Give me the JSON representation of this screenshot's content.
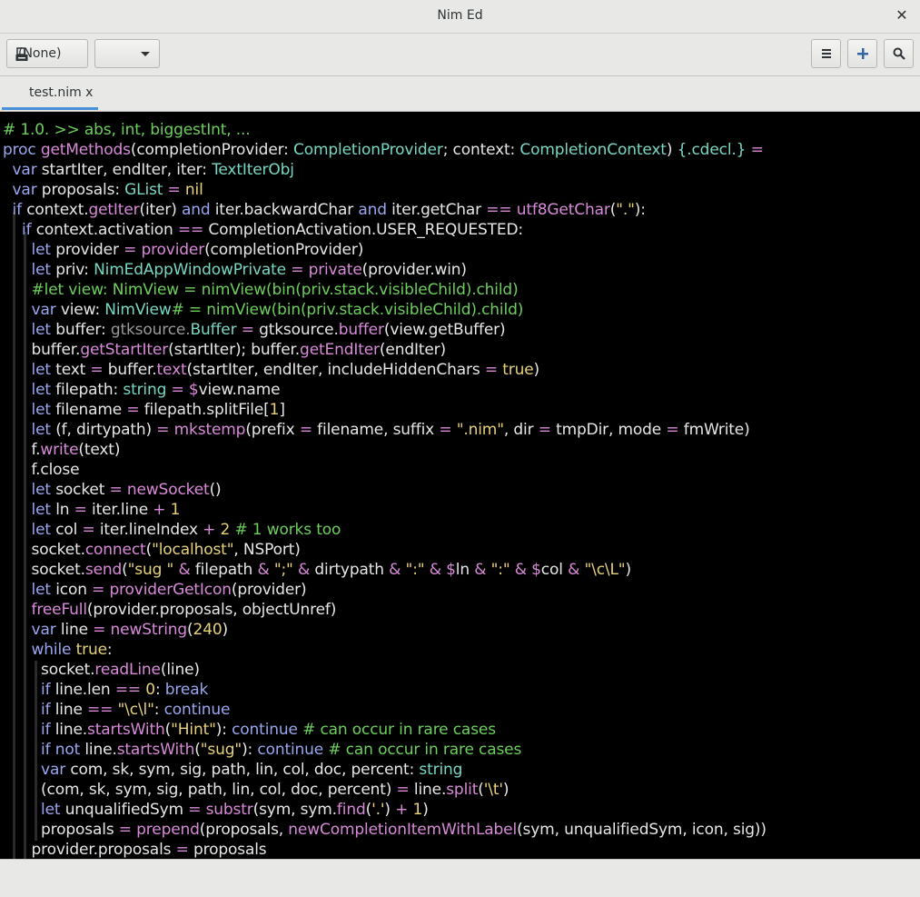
{
  "window": {
    "title": "Nim Ed",
    "close_glyph": "✕"
  },
  "toolbar": {
    "document_selector_label": "(None)",
    "document_icon": "document-icon",
    "combo_value": "",
    "menu_icon": "hamburger-menu-icon",
    "add_icon": "plus-icon",
    "search_icon": "search-icon"
  },
  "tabs": [
    {
      "label": "test.nim x",
      "active": true
    }
  ],
  "colors": {
    "default": "#e6e6e6",
    "keyword": "#9aa6ef",
    "type": "#78d7c3",
    "call": "#d88ad8",
    "comment": "#6ccf5c",
    "literal": "#e6d27a",
    "operator": "#d88ad8",
    "muted": "#9a9a9a"
  },
  "code_lines": [
    [
      [
        "# 1.0. >> abs, int, biggestInt, ...",
        "comment"
      ]
    ],
    [
      [
        "proc ",
        "keyword"
      ],
      [
        "getMethods",
        "call"
      ],
      [
        "(completionProvider",
        ""
      ],
      [
        ": ",
        ""
      ],
      [
        "CompletionProvider",
        "type"
      ],
      [
        "; context",
        ""
      ],
      [
        ": ",
        ""
      ],
      [
        "CompletionContext",
        "type"
      ],
      [
        ") ",
        ""
      ],
      [
        "{.cdecl.}",
        "type"
      ],
      [
        " =",
        "operator"
      ]
    ],
    [
      [
        "  ",
        ""
      ],
      [
        "var ",
        "keyword"
      ],
      [
        "startIter, endIter, iter",
        ""
      ],
      [
        ": ",
        ""
      ],
      [
        "TextIterObj",
        "type"
      ]
    ],
    [
      [
        "  ",
        ""
      ],
      [
        "var ",
        "keyword"
      ],
      [
        "proposals",
        ""
      ],
      [
        ": ",
        ""
      ],
      [
        "GList",
        "type"
      ],
      [
        " = ",
        "operator"
      ],
      [
        "nil",
        "literal"
      ]
    ],
    [
      [
        "  ",
        ""
      ],
      [
        "if ",
        "keyword"
      ],
      [
        "context.",
        ""
      ],
      [
        "getIter",
        "call"
      ],
      [
        "(iter) ",
        ""
      ],
      [
        "and ",
        "keyword"
      ],
      [
        "iter.backwardChar ",
        ""
      ],
      [
        "and ",
        "keyword"
      ],
      [
        "iter.getChar ",
        ""
      ],
      [
        "== ",
        "operator"
      ],
      [
        "utf8GetChar",
        "call"
      ],
      [
        "(",
        ""
      ],
      [
        "\".\"",
        "literal"
      ],
      [
        "):",
        ""
      ]
    ],
    [
      [
        "    ",
        ""
      ],
      [
        "if ",
        "keyword"
      ],
      [
        "context.activation ",
        ""
      ],
      [
        "== ",
        "operator"
      ],
      [
        "CompletionActivation.USER_REQUESTED:",
        ""
      ]
    ],
    [
      [
        "      ",
        ""
      ],
      [
        "let ",
        "keyword"
      ],
      [
        "provider ",
        ""
      ],
      [
        "= ",
        "operator"
      ],
      [
        "provider",
        "call"
      ],
      [
        "(completionProvider)",
        ""
      ]
    ],
    [
      [
        "      ",
        ""
      ],
      [
        "let ",
        "keyword"
      ],
      [
        "priv",
        ""
      ],
      [
        ": ",
        ""
      ],
      [
        "NimEdAppWindowPrivate",
        "type"
      ],
      [
        " = ",
        "operator"
      ],
      [
        "private",
        "call"
      ],
      [
        "(provider.win)",
        ""
      ]
    ],
    [
      [
        "      ",
        ""
      ],
      [
        "#let view: NimView = nimView(bin(priv.stack.visibleChild).child)",
        "comment"
      ]
    ],
    [
      [
        "      ",
        ""
      ],
      [
        "var ",
        "keyword"
      ],
      [
        "view",
        ""
      ],
      [
        ": ",
        ""
      ],
      [
        "NimView",
        "type"
      ],
      [
        "# = nimView(bin(priv.stack.visibleChild).child)",
        "comment"
      ]
    ],
    [
      [
        "      ",
        ""
      ],
      [
        "let ",
        "keyword"
      ],
      [
        "buffer",
        ""
      ],
      [
        ": ",
        ""
      ],
      [
        "gtksource.",
        "muted"
      ],
      [
        "Buffer",
        "type"
      ],
      [
        " = ",
        "operator"
      ],
      [
        "gtksource.",
        ""
      ],
      [
        "buffer",
        "call"
      ],
      [
        "(view.getBuffer)",
        ""
      ]
    ],
    [
      [
        "      ",
        ""
      ],
      [
        "buffer.",
        ""
      ],
      [
        "getStartIter",
        "call"
      ],
      [
        "(startIter); buffer.",
        ""
      ],
      [
        "getEndIter",
        "call"
      ],
      [
        "(endIter)",
        ""
      ]
    ],
    [
      [
        "      ",
        ""
      ],
      [
        "let ",
        "keyword"
      ],
      [
        "text ",
        ""
      ],
      [
        "= ",
        "operator"
      ],
      [
        "buffer.",
        ""
      ],
      [
        "text",
        "call"
      ],
      [
        "(startIter, endIter, includeHiddenChars ",
        ""
      ],
      [
        "= ",
        "operator"
      ],
      [
        "true",
        "literal"
      ],
      [
        ")",
        ""
      ]
    ],
    [
      [
        "      ",
        ""
      ],
      [
        "let ",
        "keyword"
      ],
      [
        "filepath",
        ""
      ],
      [
        ": ",
        ""
      ],
      [
        "string",
        "type"
      ],
      [
        " = ",
        "operator"
      ],
      [
        "$",
        "operator"
      ],
      [
        "view.name",
        ""
      ]
    ],
    [
      [
        "      ",
        ""
      ],
      [
        "let ",
        "keyword"
      ],
      [
        "filename ",
        ""
      ],
      [
        "= ",
        "operator"
      ],
      [
        "filepath.splitFile[",
        ""
      ],
      [
        "1",
        "literal"
      ],
      [
        "]",
        ""
      ]
    ],
    [
      [
        "      ",
        ""
      ],
      [
        "let ",
        "keyword"
      ],
      [
        "(f, dirtypath) ",
        ""
      ],
      [
        "= ",
        "operator"
      ],
      [
        "mkstemp",
        "call"
      ],
      [
        "(prefix ",
        ""
      ],
      [
        "= ",
        "operator"
      ],
      [
        "filename, suffix ",
        ""
      ],
      [
        "= ",
        "operator"
      ],
      [
        "\".nim\"",
        "literal"
      ],
      [
        ", dir ",
        ""
      ],
      [
        "= ",
        "operator"
      ],
      [
        "tmpDir, mode ",
        ""
      ],
      [
        "= ",
        "operator"
      ],
      [
        "fmWrite)",
        ""
      ]
    ],
    [
      [
        "      ",
        ""
      ],
      [
        "f.",
        ""
      ],
      [
        "write",
        "call"
      ],
      [
        "(text)",
        ""
      ]
    ],
    [
      [
        "      ",
        ""
      ],
      [
        "f.close",
        ""
      ]
    ],
    [
      [
        "      ",
        ""
      ],
      [
        "let ",
        "keyword"
      ],
      [
        "socket ",
        ""
      ],
      [
        "= ",
        "operator"
      ],
      [
        "newSocket",
        "call"
      ],
      [
        "()",
        ""
      ]
    ],
    [
      [
        "      ",
        ""
      ],
      [
        "let ",
        "keyword"
      ],
      [
        "ln ",
        ""
      ],
      [
        "= ",
        "operator"
      ],
      [
        "iter.line ",
        ""
      ],
      [
        "+ ",
        "operator"
      ],
      [
        "1",
        "literal"
      ]
    ],
    [
      [
        "      ",
        ""
      ],
      [
        "let ",
        "keyword"
      ],
      [
        "col ",
        ""
      ],
      [
        "= ",
        "operator"
      ],
      [
        "iter.lineIndex ",
        ""
      ],
      [
        "+ ",
        "operator"
      ],
      [
        "2 ",
        "literal"
      ],
      [
        "# 1 works too",
        "comment"
      ]
    ],
    [
      [
        "      ",
        ""
      ],
      [
        "socket.",
        ""
      ],
      [
        "connect",
        "call"
      ],
      [
        "(",
        ""
      ],
      [
        "\"localhost\"",
        "literal"
      ],
      [
        ", NSPort)",
        ""
      ]
    ],
    [
      [
        "      ",
        ""
      ],
      [
        "socket.",
        ""
      ],
      [
        "send",
        "call"
      ],
      [
        "(",
        ""
      ],
      [
        "\"sug \" ",
        "literal"
      ],
      [
        "& ",
        "operator"
      ],
      [
        "filepath ",
        ""
      ],
      [
        "& ",
        "operator"
      ],
      [
        "\";\" ",
        "literal"
      ],
      [
        "& ",
        "operator"
      ],
      [
        "dirtypath ",
        ""
      ],
      [
        "& ",
        "operator"
      ],
      [
        "\":\" ",
        "literal"
      ],
      [
        "& ",
        "operator"
      ],
      [
        "$",
        "operator"
      ],
      [
        "ln ",
        ""
      ],
      [
        "& ",
        "operator"
      ],
      [
        "\":\" ",
        "literal"
      ],
      [
        "& ",
        "operator"
      ],
      [
        "$",
        "operator"
      ],
      [
        "col ",
        ""
      ],
      [
        "& ",
        "operator"
      ],
      [
        "\"\\c\\L\"",
        "literal"
      ],
      [
        ")",
        ""
      ]
    ],
    [
      [
        "      ",
        ""
      ],
      [
        "let ",
        "keyword"
      ],
      [
        "icon ",
        ""
      ],
      [
        "= ",
        "operator"
      ],
      [
        "providerGetIcon",
        "call"
      ],
      [
        "(provider)",
        ""
      ]
    ],
    [
      [
        "      ",
        ""
      ],
      [
        "freeFull",
        "call"
      ],
      [
        "(provider.proposals, objectUnref)",
        ""
      ]
    ],
    [
      [
        "      ",
        ""
      ],
      [
        "var ",
        "keyword"
      ],
      [
        "line ",
        ""
      ],
      [
        "= ",
        "operator"
      ],
      [
        "newString",
        "call"
      ],
      [
        "(",
        ""
      ],
      [
        "240",
        "literal"
      ],
      [
        ")",
        ""
      ]
    ],
    [
      [
        "      ",
        ""
      ],
      [
        "while ",
        "keyword"
      ],
      [
        "true",
        "literal"
      ],
      [
        ":",
        ""
      ]
    ],
    [
      [
        "        ",
        ""
      ],
      [
        "socket.",
        ""
      ],
      [
        "readLine",
        "call"
      ],
      [
        "(line)",
        ""
      ]
    ],
    [
      [
        "        ",
        ""
      ],
      [
        "if ",
        "keyword"
      ],
      [
        "line.len ",
        ""
      ],
      [
        "== ",
        "operator"
      ],
      [
        "0",
        "literal"
      ],
      [
        ": ",
        ""
      ],
      [
        "break",
        "keyword"
      ]
    ],
    [
      [
        "        ",
        ""
      ],
      [
        "if ",
        "keyword"
      ],
      [
        "line ",
        ""
      ],
      [
        "== ",
        "operator"
      ],
      [
        "\"\\c\\l\"",
        "literal"
      ],
      [
        ": ",
        ""
      ],
      [
        "continue",
        "keyword"
      ]
    ],
    [
      [
        "        ",
        ""
      ],
      [
        "if ",
        "keyword"
      ],
      [
        "line.",
        ""
      ],
      [
        "startsWith",
        "call"
      ],
      [
        "(",
        ""
      ],
      [
        "\"Hint\"",
        "literal"
      ],
      [
        "): ",
        ""
      ],
      [
        "continue ",
        "keyword"
      ],
      [
        "# can occur in rare cases",
        "comment"
      ]
    ],
    [
      [
        "        ",
        ""
      ],
      [
        "if ",
        "keyword"
      ],
      [
        "not ",
        "keyword"
      ],
      [
        "line.",
        ""
      ],
      [
        "startsWith",
        "call"
      ],
      [
        "(",
        ""
      ],
      [
        "\"sug\"",
        "literal"
      ],
      [
        "): ",
        ""
      ],
      [
        "continue ",
        "keyword"
      ],
      [
        "# can occur in rare cases",
        "comment"
      ]
    ],
    [
      [
        "        ",
        ""
      ],
      [
        "var ",
        "keyword"
      ],
      [
        "com, sk, sym, sig, path, lin, col, doc, percent",
        ""
      ],
      [
        ": ",
        ""
      ],
      [
        "string",
        "type"
      ]
    ],
    [
      [
        "        ",
        ""
      ],
      [
        "(com, sk, sym, sig, path, lin, col, doc, percent) ",
        ""
      ],
      [
        "= ",
        "operator"
      ],
      [
        "line.",
        ""
      ],
      [
        "split",
        "call"
      ],
      [
        "(",
        ""
      ],
      [
        "'\\t'",
        "literal"
      ],
      [
        ")",
        ""
      ]
    ],
    [
      [
        "        ",
        ""
      ],
      [
        "let ",
        "keyword"
      ],
      [
        "unqualifiedSym ",
        ""
      ],
      [
        "= ",
        "operator"
      ],
      [
        "substr",
        "call"
      ],
      [
        "(sym, sym.",
        ""
      ],
      [
        "find",
        "call"
      ],
      [
        "(",
        ""
      ],
      [
        "'.'",
        "literal"
      ],
      [
        ") ",
        ""
      ],
      [
        "+ ",
        "operator"
      ],
      [
        "1",
        "literal"
      ],
      [
        ")",
        ""
      ]
    ],
    [
      [
        "        ",
        ""
      ],
      [
        "proposals ",
        ""
      ],
      [
        "= ",
        "operator"
      ],
      [
        "prepend",
        "call"
      ],
      [
        "(proposals, ",
        ""
      ],
      [
        "newCompletionItemWithLabel",
        "call"
      ],
      [
        "(sym, unqualifiedSym, icon, sig))",
        ""
      ]
    ],
    [
      [
        "      ",
        ""
      ],
      [
        "provider.proposals ",
        ""
      ],
      [
        "= ",
        "operator"
      ],
      [
        "proposals",
        ""
      ]
    ]
  ]
}
